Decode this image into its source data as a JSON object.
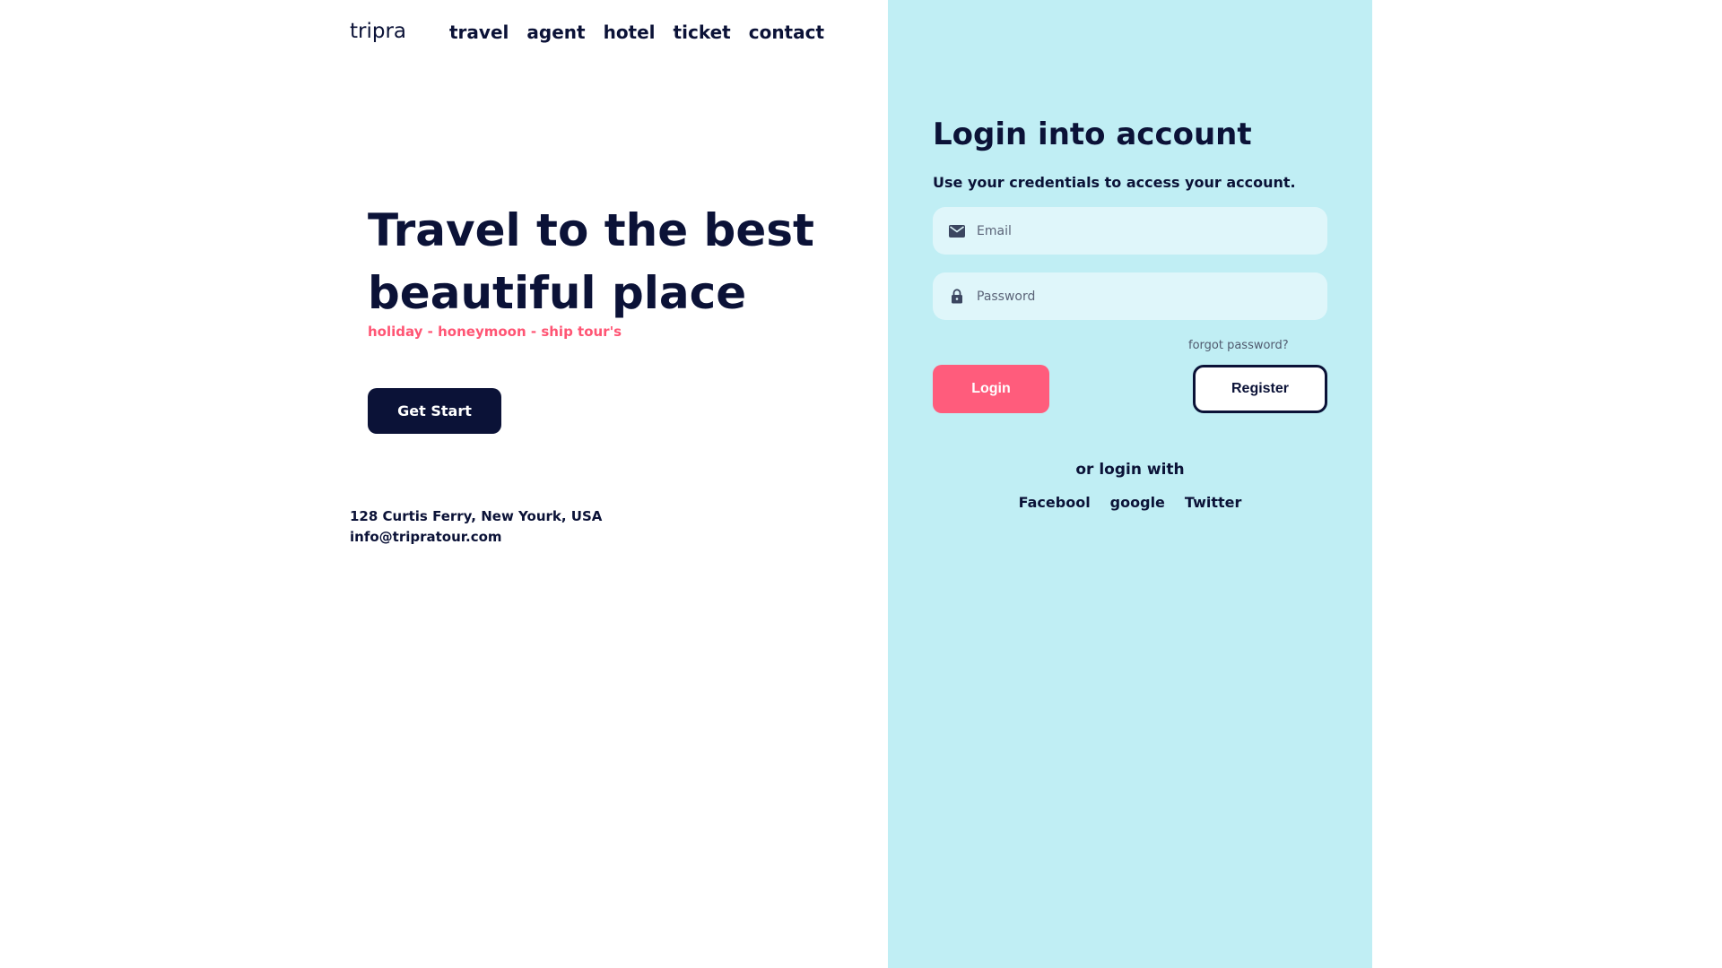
{
  "brand": {
    "logo": "tripra"
  },
  "nav": {
    "items": [
      {
        "label": "travel"
      },
      {
        "label": "agent"
      },
      {
        "label": "hotel"
      },
      {
        "label": "ticket"
      },
      {
        "label": "contact"
      }
    ]
  },
  "hero": {
    "title_line1": "Travel to the best",
    "title_line2": "beautiful place",
    "tags": "holiday - honeymoon - ship tour's",
    "cta_label": "Get Start"
  },
  "contact": {
    "address": "128 Curtis Ferry, New Yourk, USA",
    "email": "info@tripratour.com"
  },
  "login": {
    "title": "Login into account",
    "subtitle": "Use your credentials to access your account.",
    "email_placeholder": "Email",
    "password_placeholder": "Password",
    "forgot_label": "forgot password?",
    "login_label": "Login",
    "register_label": "Register",
    "or_login_with": "or login with",
    "socials": [
      {
        "label": "Facebool"
      },
      {
        "label": "google"
      },
      {
        "label": "Twitter"
      }
    ]
  },
  "colors": {
    "navy": "#0b1237",
    "accent_pink": "#ff5c7c",
    "panel_bg": "#c0eef4",
    "field_bg": "#dff6fa"
  },
  "icons": {
    "email": "mail-icon",
    "password": "lock-icon"
  }
}
